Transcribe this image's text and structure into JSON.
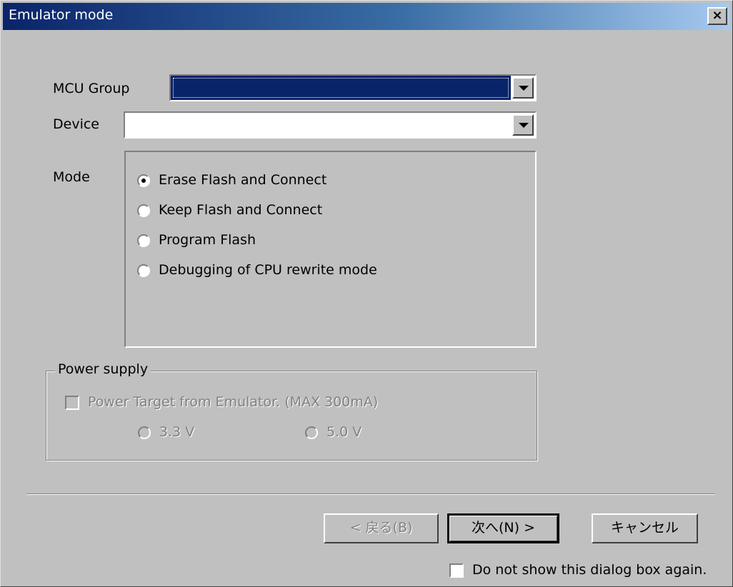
{
  "window": {
    "title": "Emulator mode",
    "close_label": "×"
  },
  "mcu_group": {
    "label": "MCU Group",
    "value": ""
  },
  "device": {
    "label": "Device",
    "value": ""
  },
  "mode": {
    "label": "Mode",
    "options": [
      {
        "label": "Erase Flash and Connect",
        "checked": true
      },
      {
        "label": "Keep Flash and Connect",
        "checked": false
      },
      {
        "label": "Program Flash",
        "checked": false
      },
      {
        "label": "Debugging of CPU rewrite mode",
        "checked": false
      }
    ]
  },
  "power_supply": {
    "label": "Power supply",
    "checkbox_label": "Power Target from Emulator. (MAX 300mA)",
    "voltage_33": "3.3 V",
    "voltage_50": "5.0 V"
  },
  "buttons": {
    "back": "< 戻る(B)",
    "next": "次へ(N) >",
    "cancel": "キャンセル"
  },
  "dont_show": {
    "label": "Do not show this dialog box again."
  }
}
